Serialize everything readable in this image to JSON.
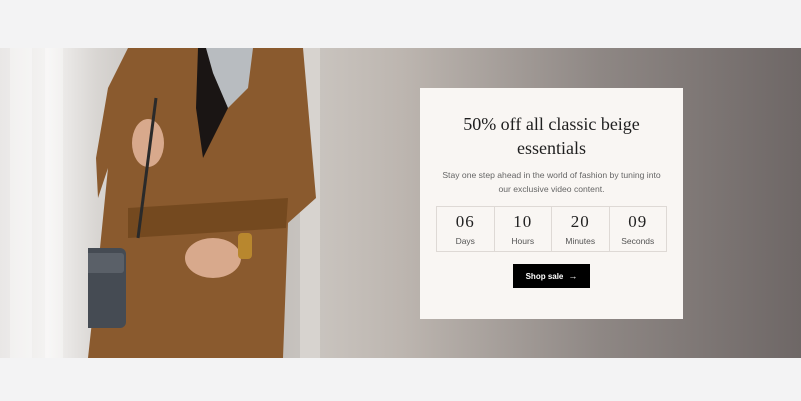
{
  "promo": {
    "title": "50% off all classic beige essentials",
    "description": "Stay one step ahead in the world of fashion by tuning into our exclusive video content.",
    "countdown": [
      {
        "value": "06",
        "label": "Days"
      },
      {
        "value": "10",
        "label": "Hours"
      },
      {
        "value": "20",
        "label": "Minutes"
      },
      {
        "value": "09",
        "label": "Seconds"
      }
    ],
    "button_label": "Shop sale",
    "button_icon": "arrow-right-icon"
  },
  "colors": {
    "page_background": "#f3f3f4",
    "card_background": "#f9f6f3",
    "button_background": "#000000",
    "coat": "#8a5a2e"
  }
}
